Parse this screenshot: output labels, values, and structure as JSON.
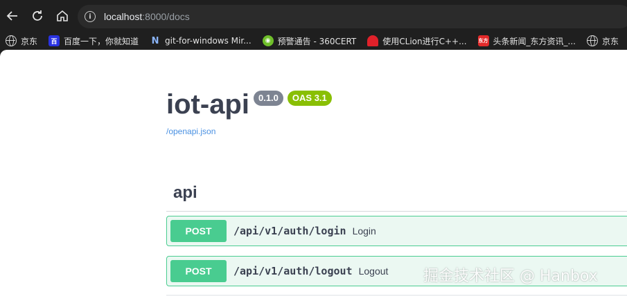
{
  "browser": {
    "url_host": "localhost",
    "url_rest": ":8000/docs",
    "icons": {
      "back": "back-arrow-icon",
      "reload": "reload-icon",
      "home": "home-icon",
      "site_info": "info-icon"
    }
  },
  "bookmarks": [
    {
      "label": "京东",
      "icon": "globe-icon"
    },
    {
      "label": "百度一下，你就知道",
      "icon": "baidu-icon",
      "color": "#2932e1"
    },
    {
      "label": "git-for-windows Mir...",
      "icon": "n-logo-icon",
      "color": "#1a73e8"
    },
    {
      "label": "预警通告 - 360CERT",
      "icon": "360cert-icon",
      "color": "#6fbf2a"
    },
    {
      "label": "使用CLion进行C++...",
      "icon": "clion-icon",
      "color": "#e0212a"
    },
    {
      "label": "头条新闻_东方资讯_...",
      "icon": "dongfang-icon",
      "color": "#e32a2a"
    },
    {
      "label": "京东",
      "icon": "globe-icon"
    }
  ],
  "doc": {
    "title": "iot-api",
    "version_badge": "0.1.0",
    "oas_badge": "OAS 3.1",
    "openapi_link": "/openapi.json",
    "colors": {
      "post": "#49cc90",
      "post_bg": "#ebf8f2",
      "version_badge": "#7d8492",
      "oas_badge": "#89bf04",
      "text": "#3b4151",
      "link": "#4990e2"
    }
  },
  "tag": {
    "name": "api"
  },
  "operations": [
    {
      "method": "POST",
      "path": "/api/v1/auth/login",
      "summary": "Login"
    },
    {
      "method": "POST",
      "path": "/api/v1/auth/logout",
      "summary": "Logout"
    }
  ],
  "watermark": "掘金技术社区 @ Hanbox"
}
